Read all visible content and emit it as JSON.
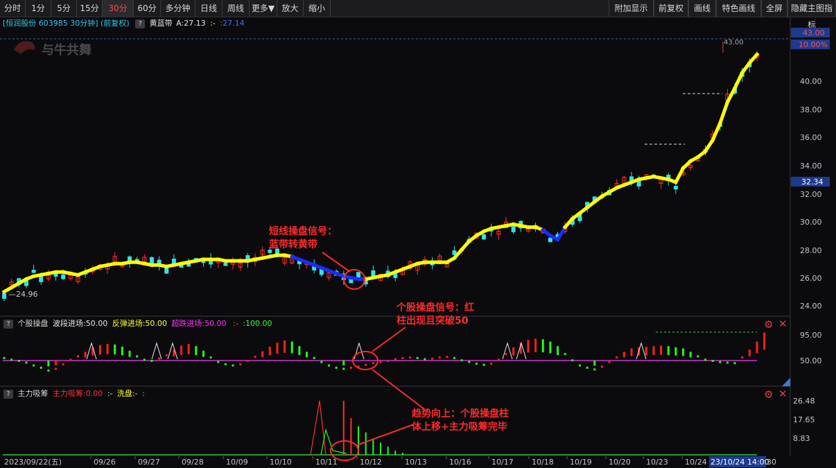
{
  "toolbar": {
    "periods": [
      "分时",
      "1分",
      "5分",
      "15分",
      "30分",
      "60分",
      "多分钟",
      "日线",
      "周线",
      "更多▼",
      "放大",
      "缩小"
    ],
    "active_period": "30分",
    "right_buttons": [
      "附加显示",
      "前复权",
      "画线",
      "特色画线",
      "全屏",
      "隐藏主图指标"
    ]
  },
  "info": {
    "stock": "[恒润股份 603985 30分钟] (前复权)",
    "indicator_name": "黄蓝带",
    "indicator_a": "A:27.13",
    "indicator_b": ":-",
    "indicator_c": ":27.14",
    "q": "?"
  },
  "watermark": "与牛共舞",
  "main_axis": {
    "ticks": [
      "43.00",
      "40.00",
      "38.00",
      "36.00",
      "34.00",
      "32.00",
      "30.00",
      "28.00",
      "26.00",
      "24.00"
    ],
    "top_label": "43.00",
    "top_pct": "10.00%",
    "cur_label": "32.34",
    "high_label": "43.00",
    "low_label": "24.96"
  },
  "osc_panel": {
    "title": "个股操盘",
    "items": [
      {
        "label": "波段进场:50.00",
        "color": "#e8e8e8"
      },
      {
        "label": "反弹进场:50.00",
        "color": "#ffff33"
      },
      {
        "label": "超跌进场:50.00",
        "color": "#ff33ff"
      },
      {
        "label": ":100.00",
        "color": "#33ff33"
      }
    ],
    "sep": ":-",
    "ticks": [
      "95.00",
      "50.00"
    ]
  },
  "funds_panel": {
    "title": "主力吸筹",
    "item1": "主力吸筹:0.00",
    "item2": "洗盘:-",
    "sep1": ":-",
    "sep2": ":",
    "ticks": [
      "26.48",
      "17.65",
      "8.83"
    ]
  },
  "date_axis": {
    "dates": [
      "2023/09/22(五)",
      "09/26",
      "09/27",
      "09/28",
      "10/09",
      "10/10",
      "10/11",
      "10/12",
      "10/13",
      "10/16",
      "10/17",
      "10/18",
      "10/19",
      "10/20",
      "10/23",
      "10/24"
    ],
    "cursor_label": "23/10/24 14:00",
    "cursor_suffix": "30"
  },
  "annotations": {
    "a1": [
      "短线操盘信号：",
      "蓝带转黄带"
    ],
    "a2": [
      "个股操盘信号：红",
      "柱出现且突破50"
    ],
    "a3": [
      "趋势向上：个股操盘柱",
      "体上移+主力吸筹完毕"
    ]
  },
  "colors": {
    "up": "#ff3030",
    "down": "#33e0ee",
    "band_up": "#ffff00",
    "band_down": "#1a2cff",
    "osc_line": "#cc33cc",
    "osc_up": "#ff2020",
    "osc_down": "#20ff20",
    "annotation": "#ff2a2a"
  },
  "price_series": [
    25.0,
    25.3,
    25.6,
    25.9,
    26.1,
    26.2,
    26.3,
    26.4,
    26.4,
    26.3,
    26.2,
    26.4,
    26.6,
    26.8,
    26.9,
    27.0,
    27.0,
    27.1,
    27.1,
    27.0,
    26.9,
    26.9,
    26.8,
    26.9,
    27.0,
    27.1,
    27.2,
    27.3,
    27.3,
    27.3,
    27.2,
    27.2,
    27.2,
    27.2,
    27.3,
    27.4,
    27.5,
    27.6,
    27.6,
    27.5,
    27.3,
    27.1,
    26.9,
    26.7,
    26.5,
    26.3,
    26.1,
    26.0,
    25.9,
    25.9,
    26.0,
    26.1,
    26.2,
    26.4,
    26.6,
    26.8,
    27.0,
    27.1,
    27.1,
    27.1,
    27.1,
    27.4,
    28.0,
    28.6,
    29.0,
    29.3,
    29.5,
    29.6,
    29.7,
    29.8,
    29.7,
    29.6,
    29.6,
    29.4,
    29.0,
    28.7,
    29.6,
    30.2,
    30.6,
    31.0,
    31.4,
    31.8,
    32.1,
    32.4,
    32.6,
    32.8,
    33.0,
    33.1,
    33.2,
    33.1,
    33.0,
    32.8,
    33.8,
    34.3,
    34.6,
    35.0,
    35.8,
    37.0,
    38.5,
    39.5,
    40.6,
    41.3,
    41.9
  ],
  "band_direction": [
    "u",
    "u",
    "u",
    "u",
    "u",
    "u",
    "u",
    "u",
    "u",
    "u",
    "u",
    "u",
    "u",
    "u",
    "u",
    "u",
    "u",
    "u",
    "u",
    "u",
    "u",
    "u",
    "u",
    "u",
    "u",
    "u",
    "u",
    "u",
    "u",
    "u",
    "u",
    "u",
    "u",
    "u",
    "u",
    "u",
    "u",
    "u",
    "u",
    "d",
    "d",
    "d",
    "d",
    "d",
    "d",
    "d",
    "d",
    "d",
    "d",
    "u",
    "u",
    "u",
    "u",
    "u",
    "u",
    "u",
    "u",
    "u",
    "u",
    "u",
    "u",
    "u",
    "u",
    "u",
    "u",
    "u",
    "u",
    "u",
    "u",
    "u",
    "u",
    "u",
    "u",
    "d",
    "d",
    "d",
    "u",
    "u",
    "u",
    "u",
    "u",
    "u",
    "u",
    "u",
    "u",
    "u",
    "u",
    "u",
    "u",
    "u",
    "u",
    "u",
    "u",
    "u",
    "u",
    "u",
    "u",
    "u",
    "u",
    "u",
    "u",
    "u",
    "u"
  ],
  "osc_series": [
    55,
    52,
    50,
    47,
    42,
    38,
    33,
    36,
    44,
    52,
    58,
    64,
    72,
    76,
    78,
    77,
    73,
    66,
    58,
    52,
    50,
    54,
    60,
    68,
    75,
    78,
    74,
    66,
    56,
    48,
    44,
    42,
    44,
    50,
    57,
    65,
    73,
    80,
    84,
    82,
    74,
    64,
    55,
    48,
    42,
    38,
    36,
    38,
    40,
    43,
    46,
    48,
    50,
    53,
    55,
    56,
    55,
    53,
    54,
    56,
    57,
    55,
    51,
    48,
    45,
    43,
    45,
    52,
    62,
    72,
    80,
    85,
    87,
    86,
    82,
    74,
    62,
    51,
    42,
    38,
    35,
    40,
    48,
    56,
    64,
    70,
    72,
    73,
    74,
    75,
    74,
    72,
    70,
    64,
    58,
    52,
    50,
    48,
    47,
    46,
    56,
    68,
    82,
    98
  ],
  "funds_series": [
    0,
    0,
    0,
    0,
    0,
    0,
    0,
    0,
    0,
    0,
    0,
    0,
    0,
    0,
    0,
    0,
    0,
    0,
    0,
    0,
    0,
    0,
    0,
    0,
    0,
    0,
    0,
    0,
    0,
    0,
    0,
    0,
    0,
    0,
    0,
    0,
    0,
    0,
    0,
    0,
    0,
    0,
    0,
    0,
    0,
    0,
    26.48,
    18,
    14,
    11,
    8,
    6,
    4,
    2,
    1,
    0,
    0,
    0,
    0,
    0,
    0,
    0,
    0,
    0,
    0,
    0,
    0,
    0,
    0,
    0,
    0,
    0,
    0,
    0,
    0,
    0,
    0,
    0,
    0,
    0,
    0,
    0,
    0,
    0,
    0,
    0,
    0,
    0,
    0,
    0,
    0,
    0,
    0,
    0,
    0,
    0,
    0,
    0,
    0,
    0,
    0,
    0,
    0
  ]
}
